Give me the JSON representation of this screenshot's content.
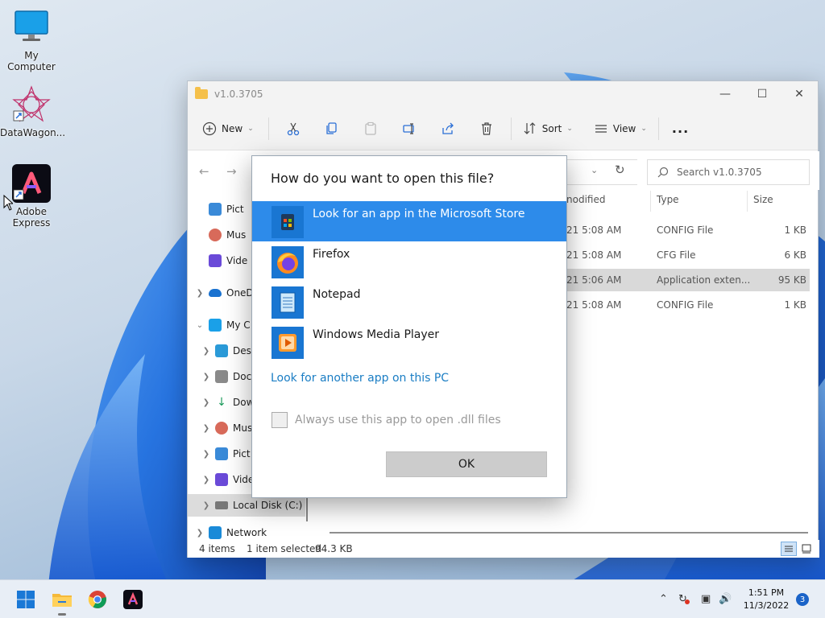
{
  "desktop": {
    "icons": [
      {
        "label": "My Computer"
      },
      {
        "label": "DataWagon..."
      },
      {
        "label": "Adobe Express"
      }
    ]
  },
  "explorer": {
    "title": "v1.0.3705",
    "toolbar": {
      "new_label": "New",
      "sort_label": "Sort",
      "view_label": "View",
      "more_label": "..."
    },
    "search_placeholder": "Search v1.0.3705",
    "sidebar": [
      {
        "label": "Pict"
      },
      {
        "label": "Mus"
      },
      {
        "label": "Vide"
      },
      {
        "label": "OneD"
      },
      {
        "label": "My C"
      },
      {
        "label": "Desl"
      },
      {
        "label": "Doc"
      },
      {
        "label": "Dow"
      },
      {
        "label": "Mus"
      },
      {
        "label": "Pict"
      },
      {
        "label": "Vide"
      },
      {
        "label": "Local Disk (C:)"
      },
      {
        "label": "Network"
      }
    ],
    "columns": {
      "modified": "nodified",
      "type": "Type",
      "size": "Size"
    },
    "rows": [
      {
        "date": "21 5:08 AM",
        "type": "CONFIG File",
        "size": "1 KB"
      },
      {
        "date": "21 5:08 AM",
        "type": "CFG File",
        "size": "6 KB"
      },
      {
        "date": "21 5:06 AM",
        "type": "Application exten...",
        "size": "95 KB"
      },
      {
        "date": "21 5:08 AM",
        "type": "CONFIG File",
        "size": "1 KB"
      }
    ],
    "status": {
      "items": "4 items",
      "selected": "1 item selected",
      "size": "94.3 KB"
    }
  },
  "dialog": {
    "title": "How do you want to open this file?",
    "apps": [
      {
        "name": "Look for an app in the Microsoft Store",
        "icon": "store-icon"
      },
      {
        "name": "Firefox",
        "icon": "firefox-icon"
      },
      {
        "name": "Notepad",
        "icon": "notepad-icon"
      },
      {
        "name": "Windows Media Player",
        "icon": "media-player-icon"
      }
    ],
    "other_link": "Look for another app on this PC",
    "always_label": "Always use this app to open .dll files",
    "ok_label": "OK"
  },
  "taskbar": {
    "time": "1:51 PM",
    "date": "11/3/2022",
    "notification_count": "3"
  }
}
